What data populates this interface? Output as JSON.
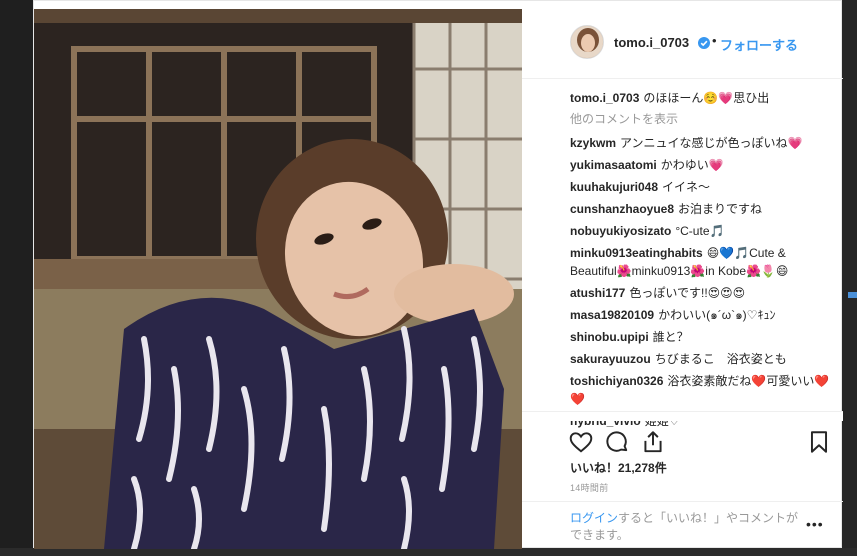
{
  "post": {
    "username": "tomo.i_0703",
    "follow_label": "フォローする",
    "separator": "•",
    "caption": {
      "username": "tomo.i_0703",
      "text": "のほほーん☺️💗思ひ出"
    },
    "more_comments": "他のコメントを表示",
    "comments": [
      {
        "user": "kzykwm",
        "text": "アンニュイな感じが色っぽいね💗"
      },
      {
        "user": "yukimasaatomi",
        "text": "かわゆい💗"
      },
      {
        "user": "kuuhakujuri048",
        "text": "イイネ〜"
      },
      {
        "user": "cunshanzhaoyue8",
        "text": "お泊まりですね"
      },
      {
        "user": "nobuyukiyosizato",
        "text": "°C-ute🎵"
      },
      {
        "user": "minku0913eatinghabits",
        "text": "😄💙🎵Cute & Beautiful🌺minku0913🌺in Kobe🌺🌷😄"
      },
      {
        "user": "atushi177",
        "text": "色っぽいです!!😍😍😍"
      },
      {
        "user": "masa19820109",
        "text": "かわいい(๑´ω`๑)♡ｷｭﾝ"
      },
      {
        "user": "shinobu.upipi",
        "text": "誰と？"
      },
      {
        "user": "sakurayuuzou",
        "text": "ちびまるこ　浴衣姿とも"
      },
      {
        "user": "toshichiyan0326",
        "text": "浴衣姿素敵だね❤️可愛いい❤️❤️"
      },
      {
        "user": "hybrid_vivio",
        "text": "姫姫♡"
      }
    ],
    "likes": "いいね！21,278件",
    "time_ago": "14時間前",
    "footer": {
      "login_link": "ログイン",
      "rest": "すると「いいね！」やコメントができます。",
      "more_icon_label": "•••"
    },
    "icons": {
      "heart": "heart-icon",
      "comment": "comment-icon",
      "share": "share-icon",
      "bookmark": "bookmark-icon",
      "verified": "verified-badge-icon"
    },
    "colors": {
      "link_blue": "#3897f0",
      "text": "#262626",
      "muted": "#999999"
    }
  }
}
